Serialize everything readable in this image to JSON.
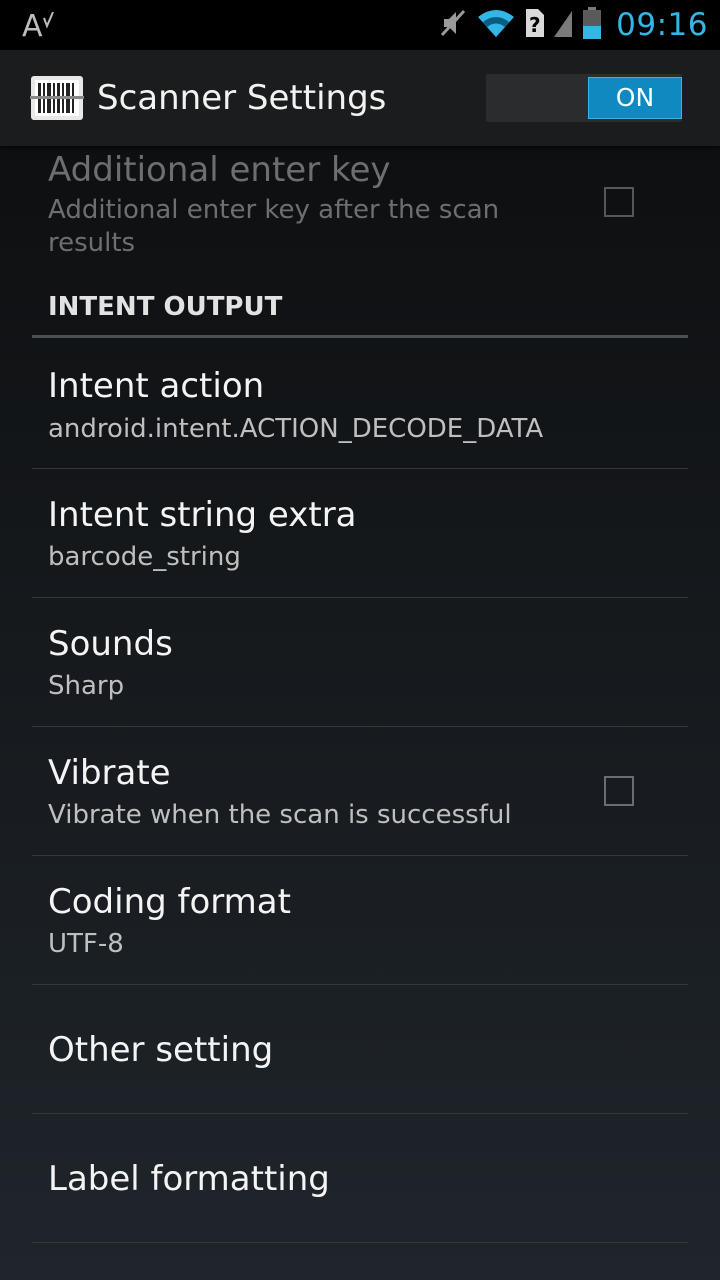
{
  "status_bar": {
    "time": "09:16",
    "icons": [
      "text-input-icon",
      "mute-icon",
      "wifi-icon",
      "no-sim-icon",
      "signal-icon",
      "battery-icon"
    ]
  },
  "action_bar": {
    "title": "Scanner Settings",
    "toggle_label": "ON",
    "accent_color": "#33b5e5"
  },
  "preferences": {
    "additional_enter": {
      "title": "Additional enter key",
      "summary_line1": "Additional enter key after the scan",
      "summary_line2": "results",
      "checked": false
    },
    "category": "INTENT OUTPUT",
    "intent_action": {
      "title": "Intent action",
      "summary": "android.intent.ACTION_DECODE_DATA"
    },
    "intent_string_extra": {
      "title": "Intent string extra",
      "summary": "barcode_string"
    },
    "sounds": {
      "title": "Sounds",
      "summary": "Sharp"
    },
    "vibrate": {
      "title": "Vibrate",
      "summary": "Vibrate when the scan is successful",
      "checked": false
    },
    "coding_format": {
      "title": "Coding format",
      "summary": "UTF-8"
    },
    "other_setting": {
      "title": "Other setting"
    },
    "label_formatting": {
      "title": "Label formatting"
    }
  }
}
